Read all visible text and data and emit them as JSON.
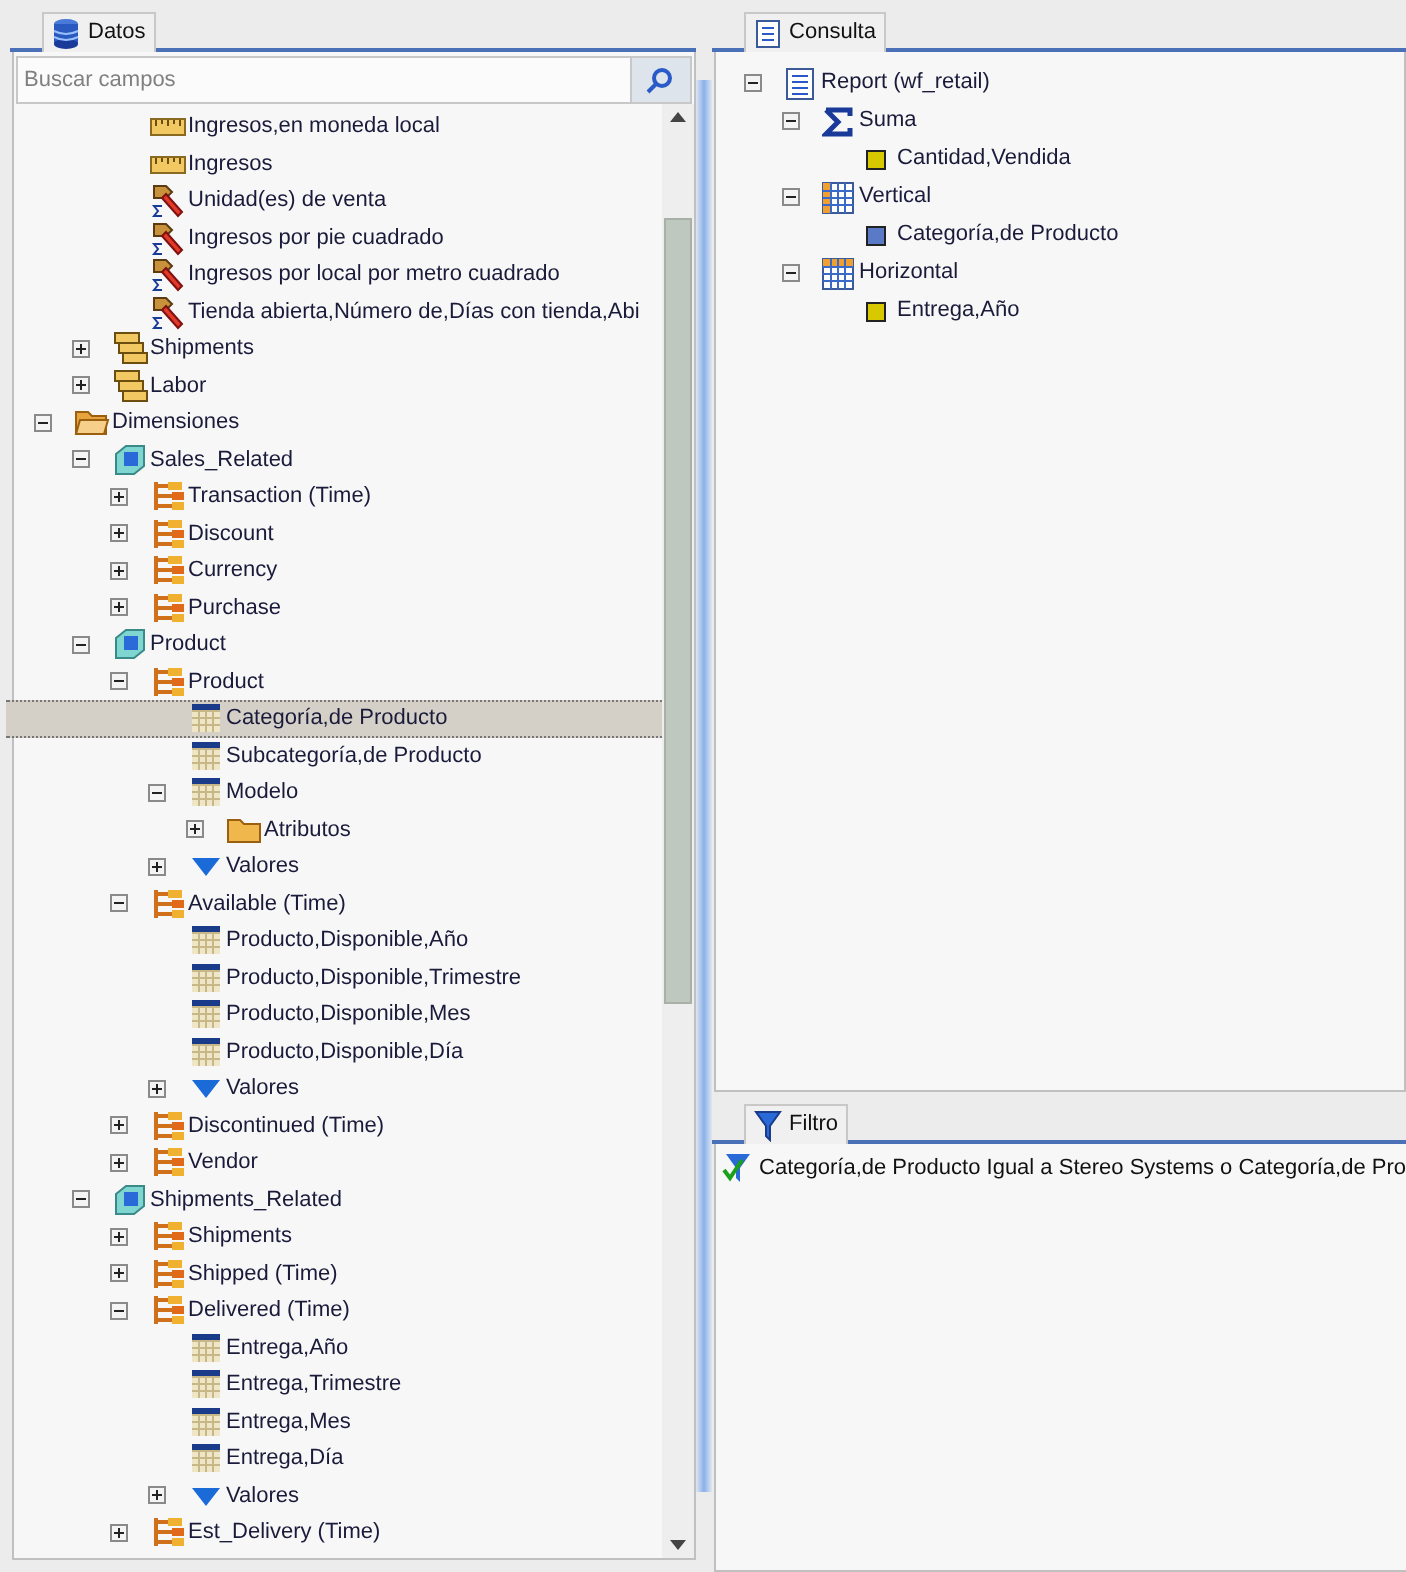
{
  "datos_panel": {
    "title": "Datos",
    "search": {
      "placeholder": "Buscar campos"
    },
    "tree": [
      {
        "children": [
          {
            "children": [
              {
                "label": "Ingresos,en moneda local",
                "kind": "ruler",
                "selected": false
              },
              {
                "label": "Ingresos",
                "kind": "ruler",
                "selected": false
              },
              {
                "label": "Unidad(es) de venta",
                "kind": "calc",
                "selected": false
              },
              {
                "label": "Ingresos por pie cuadrado",
                "kind": "calc",
                "selected": false
              },
              {
                "label": "Ingresos por local por metro cuadrado",
                "kind": "calc",
                "selected": false
              },
              {
                "label": "Tienda abierta,Número de,Días con tienda,Abi",
                "kind": "calc",
                "selected": false
              }
            ]
          },
          {
            "label": "Shipments",
            "kind": "measures",
            "expanded": false,
            "selected": false
          },
          {
            "label": "Labor",
            "kind": "measures",
            "expanded": false,
            "selected": false
          }
        ]
      },
      {
        "label": "Dimensiones",
        "kind": "folder-open",
        "expanded": true,
        "selected": false,
        "children": [
          {
            "label": "Sales_Related",
            "kind": "cube",
            "expanded": true,
            "selected": false,
            "children": [
              {
                "label": "Transaction (Time)",
                "kind": "hierarchy",
                "expanded": false,
                "selected": false
              },
              {
                "label": "Discount",
                "kind": "hierarchy",
                "expanded": false,
                "selected": false
              },
              {
                "label": "Currency",
                "kind": "hierarchy",
                "expanded": false,
                "selected": false
              },
              {
                "label": "Purchase",
                "kind": "hierarchy",
                "expanded": false,
                "selected": false
              }
            ]
          },
          {
            "label": "Product",
            "kind": "cube",
            "expanded": true,
            "selected": false,
            "children": [
              {
                "label": "Product",
                "kind": "hierarchy",
                "expanded": true,
                "selected": false,
                "children": [
                  {
                    "label": "Categoría,de Producto",
                    "kind": "level",
                    "selected": true
                  },
                  {
                    "label": "Subcategoría,de Producto",
                    "kind": "level",
                    "selected": false
                  },
                  {
                    "label": "Modelo",
                    "kind": "level",
                    "expanded": true,
                    "selected": false,
                    "children": [
                      {
                        "label": "Atributos",
                        "kind": "folder",
                        "expanded": false,
                        "selected": false
                      }
                    ]
                  },
                  {
                    "label": "Valores",
                    "kind": "values",
                    "expanded": false,
                    "selected": false
                  }
                ]
              },
              {
                "label": "Available (Time)",
                "kind": "hierarchy",
                "expanded": true,
                "selected": false,
                "children": [
                  {
                    "label": "Producto,Disponible,Año",
                    "kind": "level",
                    "selected": false
                  },
                  {
                    "label": "Producto,Disponible,Trimestre",
                    "kind": "level",
                    "selected": false
                  },
                  {
                    "label": "Producto,Disponible,Mes",
                    "kind": "level",
                    "selected": false
                  },
                  {
                    "label": "Producto,Disponible,Día",
                    "kind": "level",
                    "selected": false
                  },
                  {
                    "label": "Valores",
                    "kind": "values",
                    "expanded": false,
                    "selected": false
                  }
                ]
              },
              {
                "label": "Discontinued (Time)",
                "kind": "hierarchy",
                "expanded": false,
                "selected": false
              },
              {
                "label": "Vendor",
                "kind": "hierarchy",
                "expanded": false,
                "selected": false
              }
            ]
          },
          {
            "label": "Shipments_Related",
            "kind": "cube",
            "expanded": true,
            "selected": false,
            "children": [
              {
                "label": "Shipments",
                "kind": "hierarchy",
                "expanded": false,
                "selected": false
              },
              {
                "label": "Shipped (Time)",
                "kind": "hierarchy",
                "expanded": false,
                "selected": false
              },
              {
                "label": "Delivered (Time)",
                "kind": "hierarchy",
                "expanded": true,
                "selected": false,
                "children": [
                  {
                    "label": "Entrega,Año",
                    "kind": "level",
                    "selected": false
                  },
                  {
                    "label": "Entrega,Trimestre",
                    "kind": "level",
                    "selected": false
                  },
                  {
                    "label": "Entrega,Mes",
                    "kind": "level",
                    "selected": false
                  },
                  {
                    "label": "Entrega,Día",
                    "kind": "level",
                    "selected": false
                  },
                  {
                    "label": "Valores",
                    "kind": "values",
                    "expanded": false,
                    "selected": false
                  }
                ]
              },
              {
                "label": "Est_Delivery (Time)",
                "kind": "hierarchy",
                "expanded": false,
                "selected": false
              }
            ]
          }
        ]
      }
    ]
  },
  "consulta_panel": {
    "title": "Consulta",
    "tree": [
      {
        "label": "Report (wf_retail)",
        "kind": "report",
        "expanded": true,
        "children": [
          {
            "label": "Suma",
            "kind": "sum",
            "expanded": true,
            "children": [
              {
                "label": "Cantidad,Vendida",
                "kind": "measure"
              }
            ]
          },
          {
            "label": "Vertical",
            "kind": "grid-across",
            "expanded": true,
            "children": [
              {
                "label": "Categoría,de Producto",
                "kind": "dimension"
              }
            ]
          },
          {
            "label": "Horizontal",
            "kind": "grid-down",
            "expanded": true,
            "children": [
              {
                "label": "Entrega,Año",
                "kind": "measure"
              }
            ]
          }
        ]
      }
    ]
  },
  "filtro_panel": {
    "title": "Filtro",
    "items": [
      "Categoría,de Producto Igual a Stereo Systems o Categoría,de Pro"
    ]
  }
}
